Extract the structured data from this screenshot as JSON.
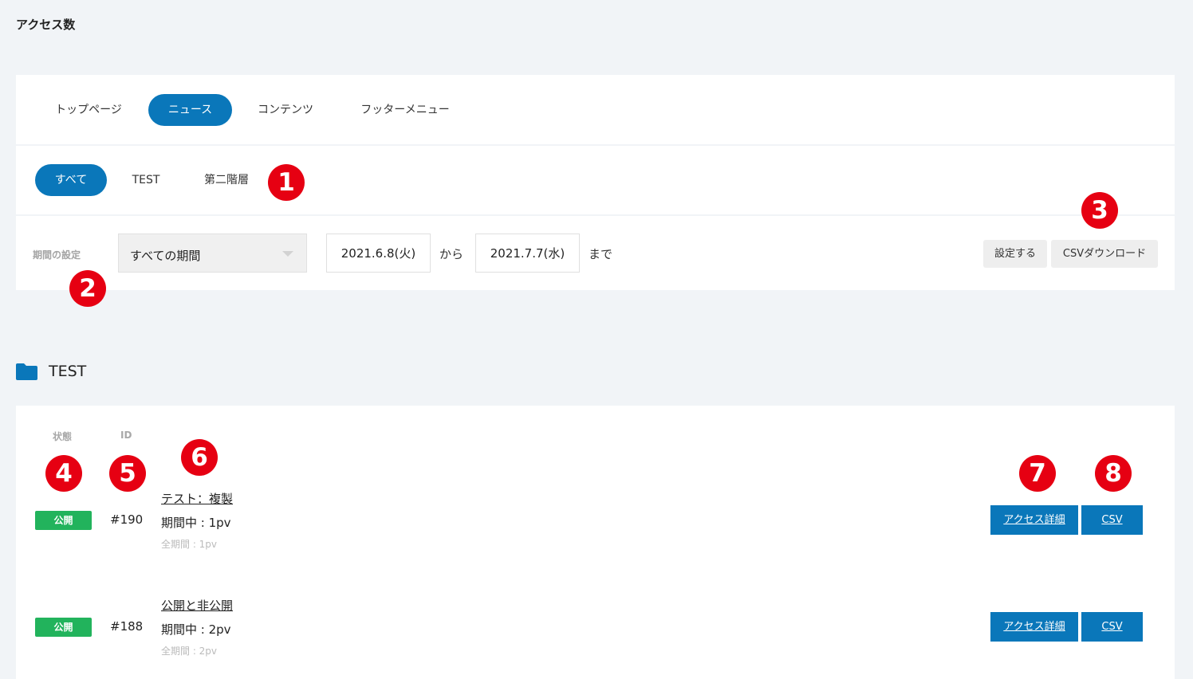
{
  "page": {
    "title": "アクセス数"
  },
  "tabs": [
    {
      "label": "トップページ",
      "active": false
    },
    {
      "label": "ニュース",
      "active": true
    },
    {
      "label": "コンテンツ",
      "active": false
    },
    {
      "label": "フッターメニュー",
      "active": false
    }
  ],
  "subtabs": [
    {
      "label": "すべて",
      "active": true
    },
    {
      "label": "TEST",
      "active": false
    },
    {
      "label": "第二階層",
      "active": false
    }
  ],
  "period": {
    "label": "期間の設定",
    "select_value": "すべての期間",
    "from_date": "2021.6.8(火)",
    "from_text": "から",
    "to_date": "2021.7.7(水)",
    "to_text": "まで",
    "apply_label": "設定する",
    "csv_download_label": "CSVダウンロード"
  },
  "section": {
    "title": "TEST",
    "icon": "folder-icon"
  },
  "list": {
    "headers": {
      "status": "状態",
      "id": "ID"
    },
    "rows": [
      {
        "status": "公開",
        "id": "#190",
        "title": "テスト：複製",
        "period": "期間中 : 1pv",
        "total": "全期間 : 1pv",
        "detail_label": "アクセス詳細",
        "csv_label": "CSV"
      },
      {
        "status": "公開",
        "id": "#188",
        "title": "公開と非公開",
        "period": "期間中 : 2pv",
        "total": "全期間 : 2pv",
        "detail_label": "アクセス詳細",
        "csv_label": "CSV"
      }
    ]
  },
  "markers": [
    "1",
    "2",
    "3",
    "4",
    "5",
    "6",
    "7",
    "8"
  ],
  "colors": {
    "accent": "#0a77ba",
    "status_public": "#22b35c",
    "marker": "#e60012",
    "background": "#f1f4f7"
  }
}
